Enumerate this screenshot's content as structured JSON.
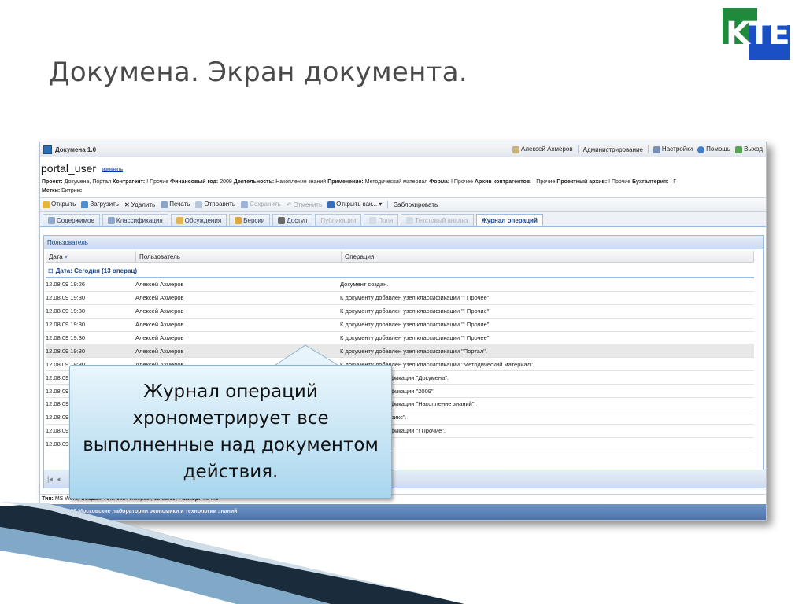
{
  "slide": {
    "title": "Докумена. Экран документа."
  },
  "logo": {
    "text": "KTE",
    "colors": {
      "green": "#1f8a3b",
      "blue": "#1b4fc4"
    }
  },
  "app": {
    "title": "Докумена 1.0",
    "user_name": "Алексей Ахмеров",
    "nav": [
      "Администрирование",
      "Настройки",
      "Помощь",
      "Выход"
    ]
  },
  "document": {
    "user": "portal_user",
    "change_link": "изменить",
    "properties": [
      {
        "label": "Проект:",
        "value": "Докумена, Портал"
      },
      {
        "label": "Контрагент:",
        "value": "! Прочие"
      },
      {
        "label": "Финансовый год:",
        "value": "2009"
      },
      {
        "label": "Деятельность:",
        "value": "Накопление знаний"
      },
      {
        "label": "Применение:",
        "value": "Методический материал"
      },
      {
        "label": "Форма:",
        "value": "! Прочее"
      },
      {
        "label": "Архив контрагентов:",
        "value": "! Прочие"
      },
      {
        "label": "Проектный архив:",
        "value": "! Прочие"
      },
      {
        "label": "Бухгалтерия:",
        "value": "! Г"
      }
    ],
    "tags_label": "Метки:",
    "tags_value": "Битрикс"
  },
  "toolbar": {
    "open": "Открыть",
    "upload": "Загрузить",
    "delete": "Удалить",
    "print": "Печать",
    "send": "Отправить",
    "save": "Сохранить",
    "cancel": "Отменить",
    "open_as": "Открыть как...",
    "lock": "Заблокировать"
  },
  "tabs": [
    {
      "label": "Содержимое",
      "state": "normal"
    },
    {
      "label": "Классификация",
      "state": "normal"
    },
    {
      "label": "Обсуждения",
      "state": "normal"
    },
    {
      "label": "Версии",
      "state": "normal"
    },
    {
      "label": "Доступ",
      "state": "normal"
    },
    {
      "label": "Публикации",
      "state": "disabled"
    },
    {
      "label": "Поля",
      "state": "disabled"
    },
    {
      "label": "Текстовый анализ",
      "state": "disabled"
    },
    {
      "label": "Журнал операций",
      "state": "active"
    }
  ],
  "grid": {
    "panel_title": "Пользователь",
    "columns": [
      "Дата",
      "Пользователь",
      "Операция"
    ],
    "group_label": "Дата: Сегодня (13 операц)",
    "rows": [
      {
        "date": "12.08.09 19:26",
        "user": "Алексей Ахмеров",
        "op": "Документ создан."
      },
      {
        "date": "12.08.09 19:30",
        "user": "Алексей Ахмеров",
        "op": "К документу добавлен узел классификации \"! Прочее\"."
      },
      {
        "date": "12.08.09 19:30",
        "user": "Алексей Ахмеров",
        "op": "К документу добавлен узел классификации \"! Прочие\"."
      },
      {
        "date": "12.08.09 19:30",
        "user": "Алексей Ахмеров",
        "op": "К документу добавлен узел классификации \"! Прочие\"."
      },
      {
        "date": "12.08.09 19:30",
        "user": "Алексей Ахмеров",
        "op": "К документу добавлен узел классификации \"! Прочее\"."
      },
      {
        "date": "12.08.09 19:30",
        "user": "Алексей Ахмеров",
        "op": "К документу добавлен узел классификации \"Портал\"."
      },
      {
        "date": "12.08.09 19:30",
        "user": "Алексей Ахмеров",
        "op": "К документу добавлен узел классификации \"Методический материал\"."
      },
      {
        "date": "12.08.09",
        "user": "",
        "op": "авлен узел классификации \"Докумена\"."
      },
      {
        "date": "12.08.09",
        "user": "",
        "op": "авлен узел классификации \"2009\"."
      },
      {
        "date": "12.08.09",
        "user": "",
        "op": "авлен узел классификации \"Накопление знаний\"."
      },
      {
        "date": "12.08.09",
        "user": "",
        "op": "авлена метка \"Битрикс\"."
      },
      {
        "date": "12.08.09",
        "user": "",
        "op": "авлен узел классификации \"! Прочие\"."
      },
      {
        "date": "12.08.09",
        "user": "",
        "op": "арий"
      }
    ],
    "selected_row": 5
  },
  "status": {
    "type_label": "Тип:",
    "type_value": "MS Word,",
    "created_label": "Создан:",
    "created_value": "Алексей Ахмеров , 12.08.09,",
    "size_label": "Размер:",
    "size_value": "4.3 Мб"
  },
  "footer": {
    "text": "©2005—2008 Московские лаборатории экономики и технологии знаний."
  },
  "callout": {
    "text": "Журнал операций хронометрирует все выполненные над документом действия."
  }
}
